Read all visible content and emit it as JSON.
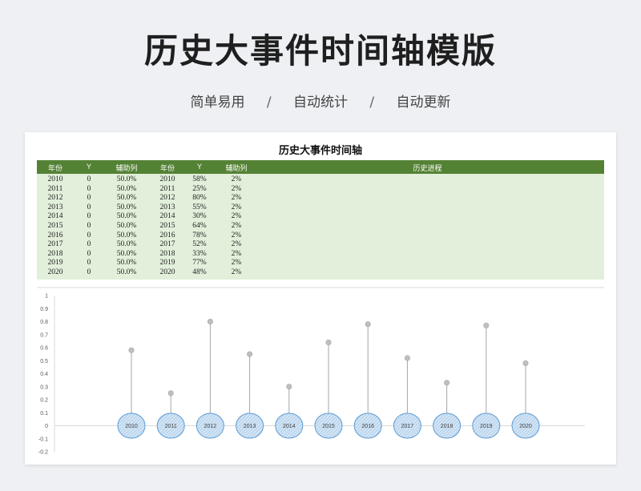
{
  "header": {
    "title": "历史大事件时间轴模版",
    "features": [
      "简单易用",
      "自动统计",
      "自动更新"
    ],
    "separator": "/"
  },
  "sheet": {
    "title": "历史大事件时间轴",
    "columns": [
      "年份",
      "Y",
      "辅助列",
      "年份",
      "Y",
      "辅助列",
      "历史进程"
    ],
    "rows": [
      [
        "2010",
        "0",
        "50.0%",
        "2010",
        "58%",
        "2%"
      ],
      [
        "2011",
        "0",
        "50.0%",
        "2011",
        "25%",
        "2%"
      ],
      [
        "2012",
        "0",
        "50.0%",
        "2012",
        "80%",
        "2%"
      ],
      [
        "2013",
        "0",
        "50.0%",
        "2013",
        "55%",
        "2%"
      ],
      [
        "2014",
        "0",
        "50.0%",
        "2014",
        "30%",
        "2%"
      ],
      [
        "2015",
        "0",
        "50.0%",
        "2015",
        "64%",
        "2%"
      ],
      [
        "2016",
        "0",
        "50.0%",
        "2016",
        "78%",
        "2%"
      ],
      [
        "2017",
        "0",
        "50.0%",
        "2017",
        "52%",
        "2%"
      ],
      [
        "2018",
        "0",
        "50.0%",
        "2018",
        "33%",
        "2%"
      ],
      [
        "2019",
        "0",
        "50.0%",
        "2019",
        "77%",
        "2%"
      ],
      [
        "2020",
        "0",
        "50.0%",
        "2020",
        "48%",
        "2%"
      ]
    ]
  },
  "chart_data": {
    "type": "scatter",
    "categories": [
      "2010",
      "2011",
      "2012",
      "2013",
      "2014",
      "2015",
      "2016",
      "2017",
      "2018",
      "2019",
      "2020"
    ],
    "values": [
      0.58,
      0.25,
      0.8,
      0.55,
      0.3,
      0.64,
      0.78,
      0.52,
      0.33,
      0.77,
      0.48
    ],
    "ylim": [
      -0.2,
      1
    ],
    "yticks": [
      "1",
      "0.9",
      "0.8",
      "0.7",
      "0.6",
      "0.5",
      "0.4",
      "0.3",
      "0.2",
      "0.1",
      "0",
      "-0.1",
      "-0.2"
    ],
    "colors": {
      "stem": "#a6a6a6",
      "point": "#bfbfbf",
      "bubble_fill": "#bdd7ee",
      "bubble_stroke": "#5b9bd5"
    }
  }
}
